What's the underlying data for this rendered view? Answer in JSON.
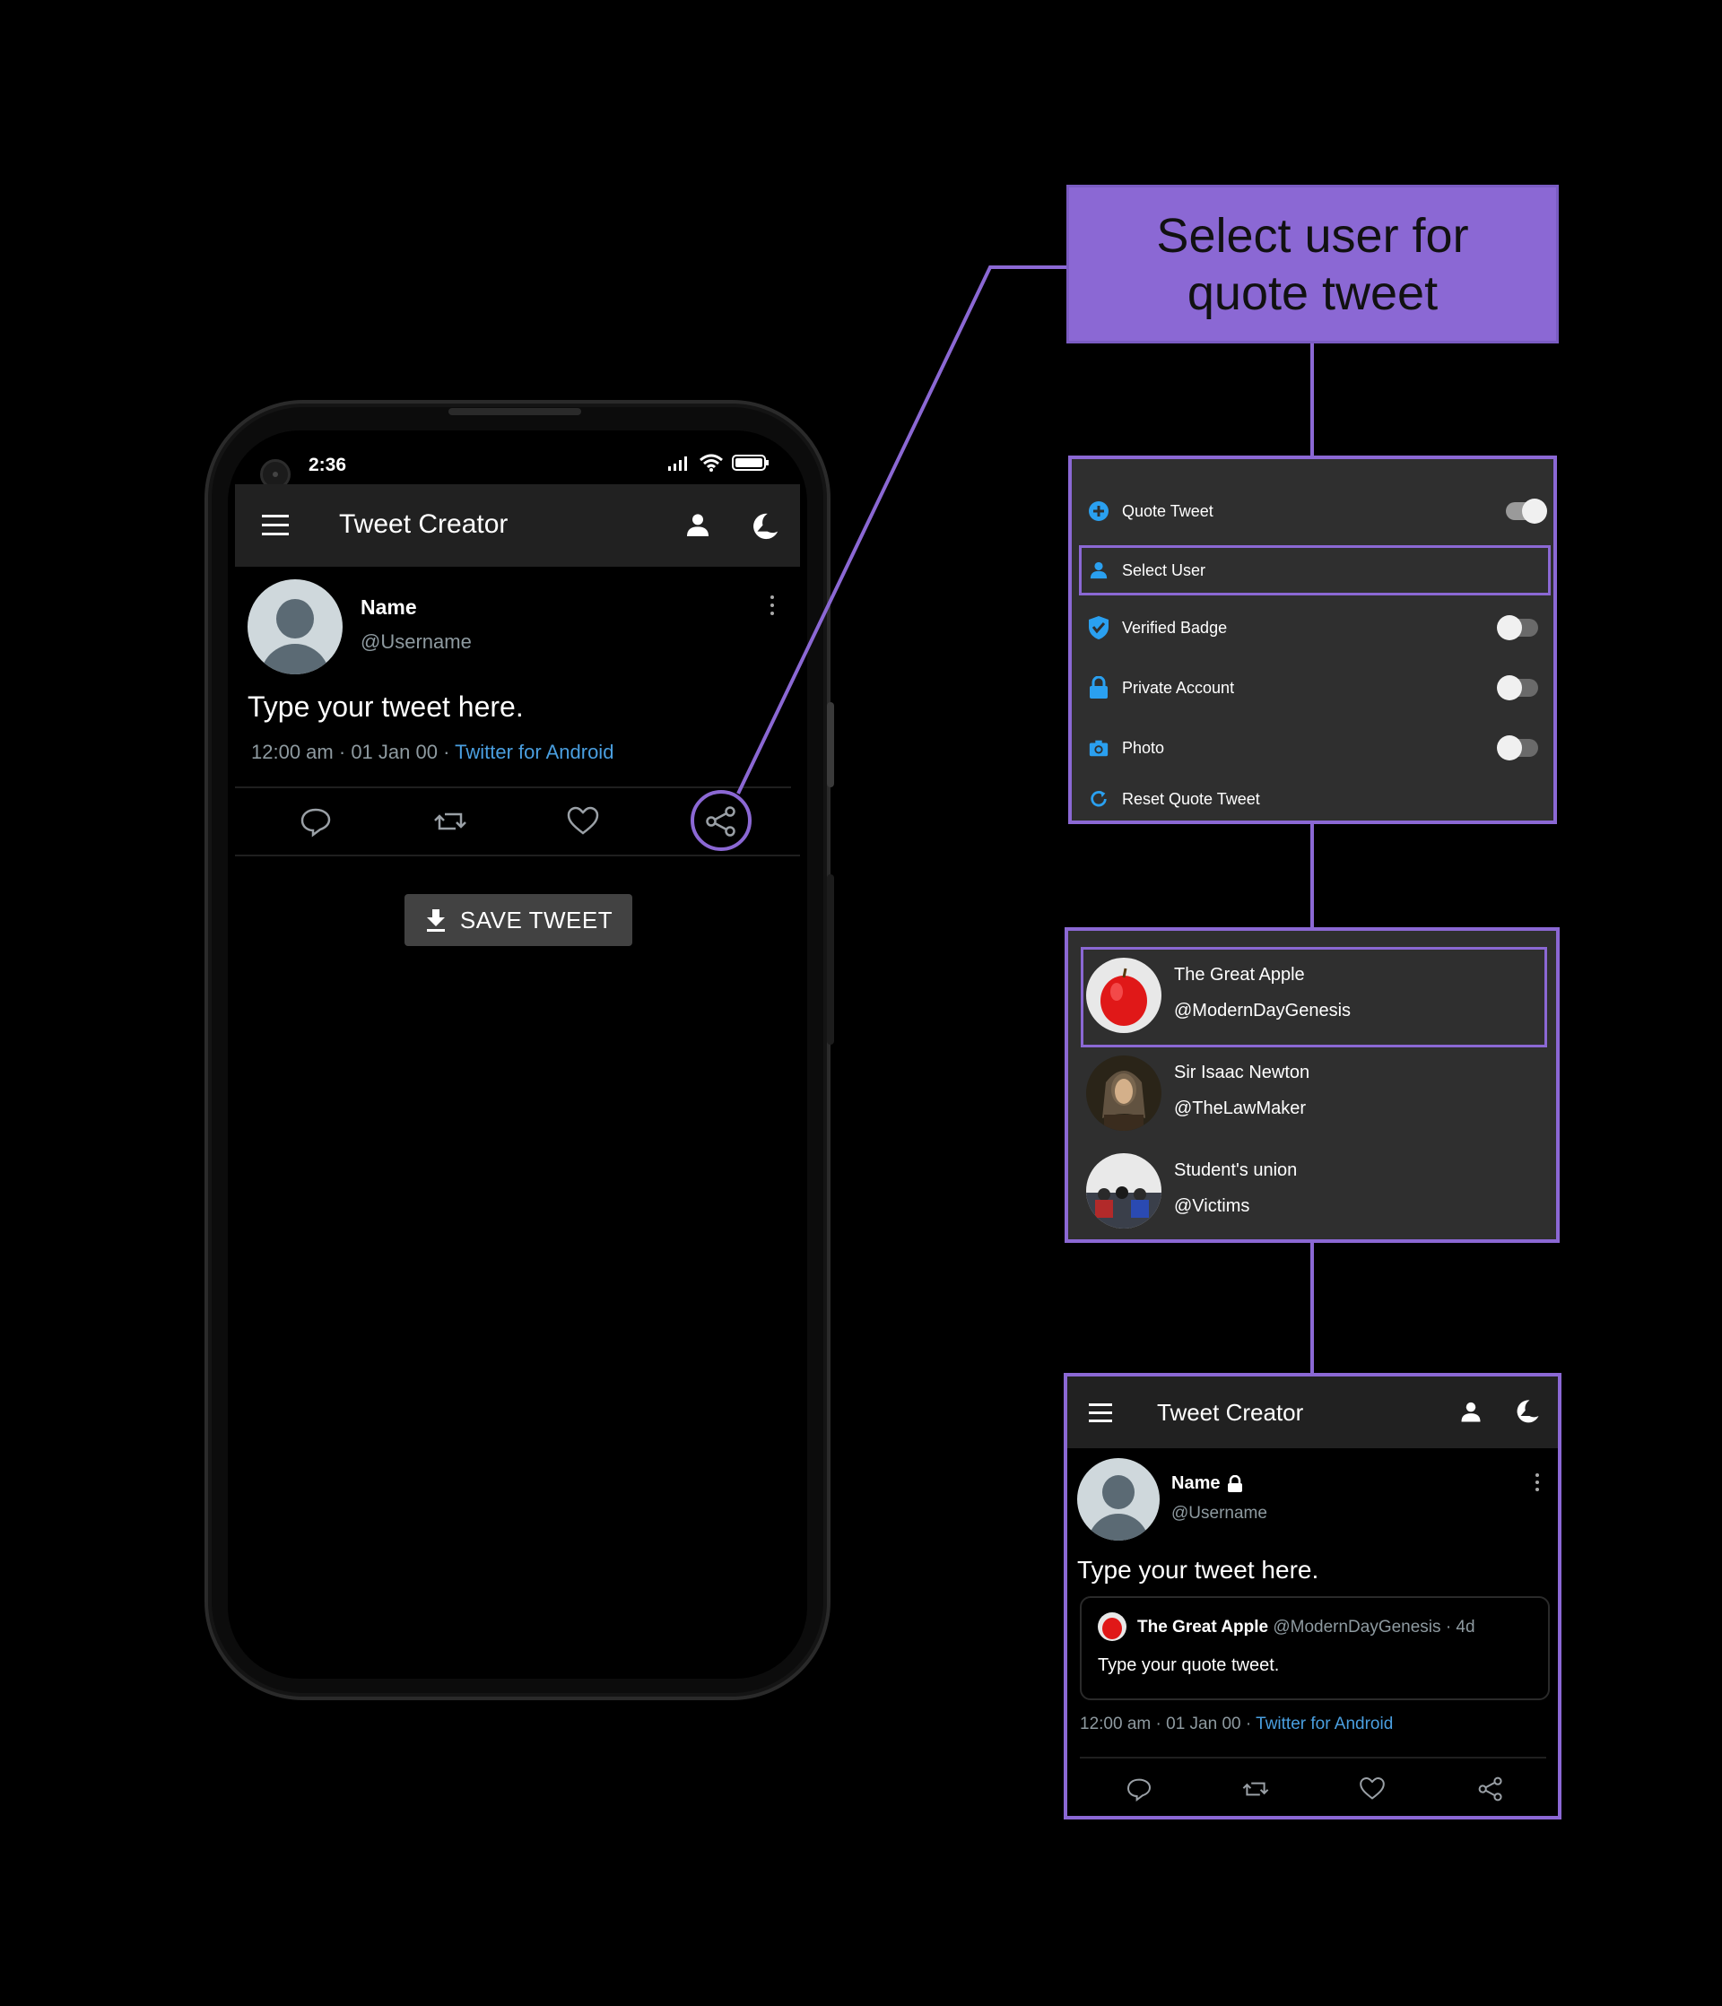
{
  "phone": {
    "status_time": "2:36",
    "app_title": "Tweet Creator",
    "tweet": {
      "name": "Name",
      "username": "@Username",
      "text": "Type your tweet here.",
      "time": "12:00 am",
      "date": "01 Jan 00",
      "source": "Twitter for Android",
      "dot": "·"
    },
    "save_label": "SAVE TWEET"
  },
  "callout": {
    "line1": "Select user for",
    "line2": "quote tweet"
  },
  "settings": {
    "quote_tweet": "Quote Tweet",
    "select_user": "Select User",
    "verified_badge": "Verified Badge",
    "private_account": "Private Account",
    "photo": "Photo",
    "reset_quote_tweet": "Reset Quote Tweet",
    "toggles": {
      "quote_tweet": true,
      "verified_badge": false,
      "private_account": false,
      "photo": false
    }
  },
  "users": [
    {
      "name": "The Great Apple",
      "handle": "@ModernDayGenesis",
      "selected": true
    },
    {
      "name": "Sir Isaac Newton",
      "handle": "@TheLawMaker",
      "selected": false
    },
    {
      "name": "Student's union",
      "handle": "@Victims",
      "selected": false
    }
  ],
  "result": {
    "app_title": "Tweet Creator",
    "name": "Name",
    "username": "@Username",
    "text": "Type your tweet here.",
    "quote": {
      "name": "The Great Apple",
      "handle": "@ModernDayGenesis",
      "age": "· 4d",
      "text": "Type your quote tweet."
    },
    "time": "12:00 am",
    "date": "01 Jan 00",
    "source": "Twitter for Android",
    "dot": "·"
  },
  "colors": {
    "accent": "#8b68d4",
    "link": "#4a9fe0",
    "panel_bg": "#2f2f2f",
    "appbar_bg": "#212121",
    "verified": "#2aa0f0"
  }
}
